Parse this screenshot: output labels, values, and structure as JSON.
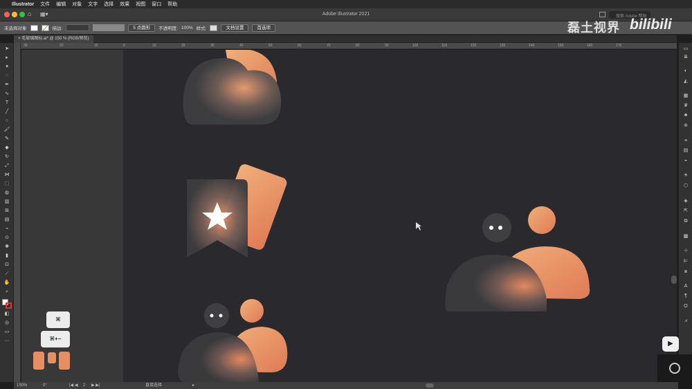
{
  "menubar": {
    "app_name": "Illustrator",
    "items": [
      "文件",
      "编辑",
      "对象",
      "文字",
      "选择",
      "效果",
      "视图",
      "窗口",
      "帮助"
    ]
  },
  "window": {
    "title": "Adobe Illustrator 2021",
    "search_placeholder": "搜索 Adobe 帮助"
  },
  "control_bar": {
    "selection": "未选择对象",
    "stroke_label": "描边:",
    "brush": "5 点圆形",
    "opacity_label": "不透明度:",
    "opacity_value": "100%",
    "style_label": "样式:",
    "doc_setup": "文档设置",
    "preferences": "首选项"
  },
  "document_tab": {
    "label": "毛玻璃图标.ai* @ 150 % (RGB/预览)"
  },
  "watermark": {
    "channel": "磊土视界",
    "site": "bilibili"
  },
  "ruler": {
    "labels": [
      "30",
      "20",
      "10",
      "0",
      "10",
      "20",
      "30",
      "40",
      "50",
      "60",
      "70",
      "80",
      "90",
      "100",
      "110",
      "120",
      "130",
      "140",
      "150",
      "160",
      "170"
    ]
  },
  "keys": {
    "cmd": "⌘",
    "cmd_minus": "⌘+−"
  },
  "status_bar": {
    "zoom": "150%",
    "angle": "0°",
    "artboard": "2",
    "tool": "直接选择"
  },
  "colors": {
    "artboard": "#2a2a2e",
    "accent_orange": "#e8996a",
    "glass_gray": "#3c3c3e"
  }
}
